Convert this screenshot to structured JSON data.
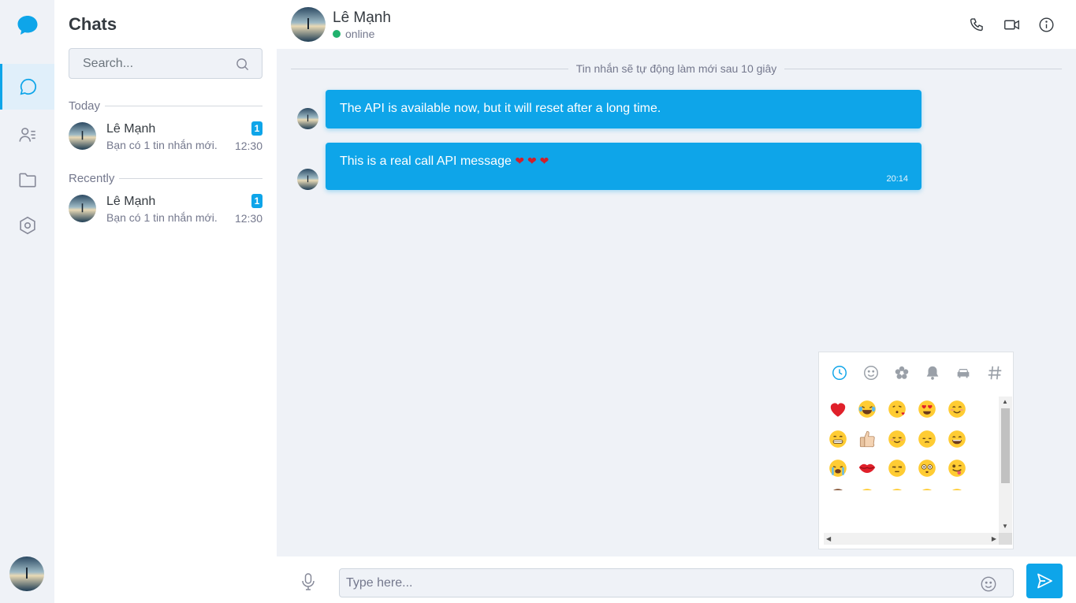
{
  "sidebar": {
    "nav": [
      {
        "icon": "chat-bubble-icon",
        "active": true
      },
      {
        "icon": "contacts-icon",
        "active": false
      },
      {
        "icon": "folder-icon",
        "active": false
      },
      {
        "icon": "settings-icon",
        "active": false
      }
    ]
  },
  "chat_list": {
    "title": "Chats",
    "search_placeholder": "Search...",
    "sections": [
      {
        "label": "Today",
        "items": [
          {
            "name": "Lê Mạnh",
            "preview": "Bạn có 1 tin nhắn mới.",
            "badge": "1",
            "time": "12:30"
          }
        ]
      },
      {
        "label": "Recently",
        "items": [
          {
            "name": "Lê Mạnh",
            "preview": "Bạn có 1 tin nhắn mới.",
            "badge": "1",
            "time": "12:30"
          }
        ]
      }
    ]
  },
  "conversation": {
    "contact_name": "Lê Mạnh",
    "status": "online",
    "divider": "Tin nhắn sẽ tự động làm mới sau 10 giây",
    "messages": [
      {
        "text": "The API is available now, but it will reset after a long time.",
        "hearts": "",
        "time": ""
      },
      {
        "text": "This is a real call API message",
        "hearts": "❤ ❤ ❤",
        "time": "20:14"
      }
    ]
  },
  "emoji_picker": {
    "tabs": [
      "clock-icon",
      "smiley-icon",
      "flower-icon",
      "bell-icon",
      "car-icon",
      "hash-icon"
    ],
    "emojis": [
      [
        "❤️",
        "😂",
        "😘",
        "😍",
        "😊"
      ],
      [
        "😁",
        "👍",
        "☺️",
        "😔",
        "😄"
      ],
      [
        "😭",
        "💋",
        "😒",
        "😳",
        "😜"
      ],
      [
        "🙈",
        "😉",
        "😃",
        "😢",
        "😝"
      ],
      [
        "😱",
        "😡",
        "😏",
        "😞",
        "😅"
      ]
    ]
  },
  "composer": {
    "placeholder": "Type here..."
  },
  "colors": {
    "accent": "#0ea5e9",
    "online": "#21b26e",
    "background": "#eff2f7"
  }
}
